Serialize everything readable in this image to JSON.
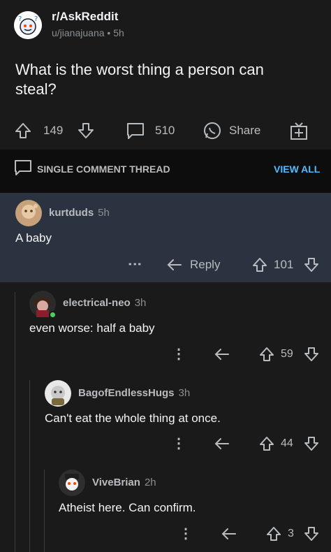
{
  "post": {
    "subreddit": "r/AskReddit",
    "author": "u/jianajuana",
    "age": "5h",
    "title": "What is the worst thing a person can steal?",
    "upvotes": "149",
    "comments": "510",
    "share_label": "Share"
  },
  "thread_bar": {
    "label": "SINGLE COMMENT THREAD",
    "view_all": "VIEW ALL"
  },
  "comments": [
    {
      "author": "kurtduds",
      "age": "5h",
      "body": "A baby",
      "reply_label": "Reply",
      "votes": "101"
    },
    {
      "author": "electrical-neo",
      "age": "3h",
      "body": "even worse: half a baby",
      "votes": "59"
    },
    {
      "author": "BagofEndlessHugs",
      "age": "3h",
      "body": "Can't eat the whole thing at once.",
      "votes": "44"
    },
    {
      "author": "ViveBrian",
      "age": "2h",
      "body": "Atheist here. Can confirm.",
      "votes": "3"
    }
  ],
  "colors": {
    "background": "#1a1a1b",
    "highlight": "#2a333f",
    "link": "#4fbcff",
    "online_dot": "#46d160"
  }
}
